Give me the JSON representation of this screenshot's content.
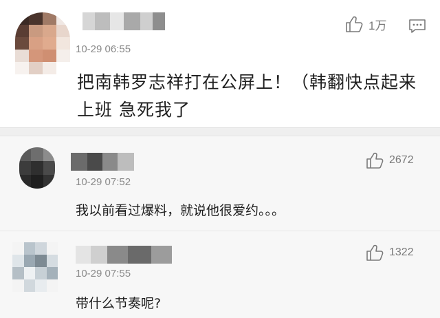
{
  "main_comment": {
    "time": "10-29 06:55",
    "like_count": "1万",
    "content_line1": "把南韩罗志祥打在公屏上！（韩翻快点起来",
    "content_line2": "上班 急死我了"
  },
  "replies": [
    {
      "time": "10-29 07:52",
      "like_count": "2672",
      "content": "我以前看过爆料，就说他很爱约。。。"
    },
    {
      "time": "10-29 07:55",
      "like_count": "1322",
      "content": "带什么节奏呢?"
    }
  ],
  "icons": {
    "like": "thumbs-up-icon",
    "comment": "comment-icon"
  }
}
